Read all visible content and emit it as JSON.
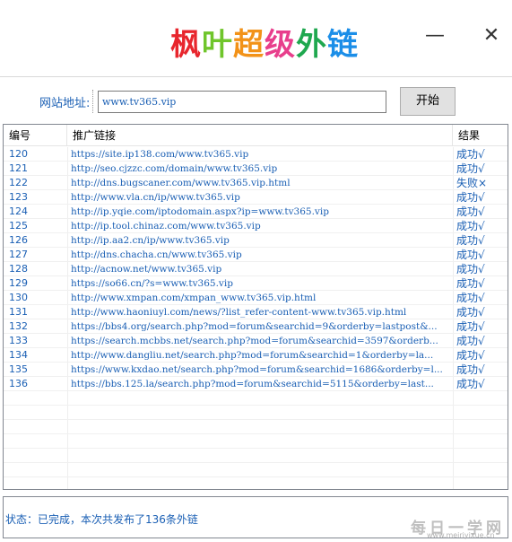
{
  "window": {
    "title_chars": [
      {
        "char": "枫",
        "color": "#e8262d"
      },
      {
        "char": "叶",
        "color": "#6fc52b"
      },
      {
        "char": "超",
        "color": "#f29218"
      },
      {
        "char": "级",
        "color": "#e83e8c"
      },
      {
        "char": "外",
        "color": "#1fa84f"
      },
      {
        "char": "链",
        "color": "#1b8ee8"
      }
    ],
    "minimize_glyph": "—",
    "close_glyph": "✕"
  },
  "form": {
    "url_label": "网站地址:",
    "url_value": "www.tv365.vip",
    "start_button": "开始"
  },
  "table": {
    "headers": {
      "id": "编号",
      "link": "推广链接",
      "result": "结果"
    },
    "rows": [
      {
        "id": "120",
        "link": "https://site.ip138.com/www.tv365.vip",
        "result": "成功√"
      },
      {
        "id": "121",
        "link": "http://seo.cjzzc.com/domain/www.tv365.vip",
        "result": "成功√"
      },
      {
        "id": "122",
        "link": "http://dns.bugscaner.com/www.tv365.vip.html",
        "result": "失败×"
      },
      {
        "id": "123",
        "link": "http://www.vla.cn/ip/www.tv365.vip",
        "result": "成功√"
      },
      {
        "id": "124",
        "link": "http://ip.yqie.com/iptodomain.aspx?ip=www.tv365.vip",
        "result": "成功√"
      },
      {
        "id": "125",
        "link": "http://ip.tool.chinaz.com/www.tv365.vip",
        "result": "成功√"
      },
      {
        "id": "126",
        "link": "http://ip.aa2.cn/ip/www.tv365.vip",
        "result": "成功√"
      },
      {
        "id": "127",
        "link": "http://dns.chacha.cn/www.tv365.vip",
        "result": "成功√"
      },
      {
        "id": "128",
        "link": "http://acnow.net/www.tv365.vip",
        "result": "成功√"
      },
      {
        "id": "129",
        "link": "https://so66.cn/?s=www.tv365.vip",
        "result": "成功√"
      },
      {
        "id": "130",
        "link": "http://www.xmpan.com/xmpan_www.tv365.vip.html",
        "result": "成功√"
      },
      {
        "id": "131",
        "link": "http://www.haoniuyl.com/news/?list_refer-content-www.tv365.vip.html",
        "result": "成功√"
      },
      {
        "id": "132",
        "link": "https://bbs4.org/search.php?mod=forum&searchid=9&orderby=lastpost&...",
        "result": "成功√"
      },
      {
        "id": "133",
        "link": "https://search.mcbbs.net/search.php?mod=forum&searchid=3597&orderb...",
        "result": "成功√"
      },
      {
        "id": "134",
        "link": "http://www.dangliu.net/search.php?mod=forum&searchid=1&orderby=la...",
        "result": "成功√"
      },
      {
        "id": "135",
        "link": "https://www.kxdao.net/search.php?mod=forum&searchid=1686&orderby=l...",
        "result": "成功√"
      },
      {
        "id": "136",
        "link": "https://bbs.125.la/search.php?mod=forum&searchid=5115&orderby=last...",
        "result": "成功√"
      }
    ]
  },
  "status": {
    "text": "状态：已完成，本次共发布了136条外链"
  },
  "watermark": {
    "main": "每日一学网",
    "sub": "www.meiriyixue.cn"
  }
}
